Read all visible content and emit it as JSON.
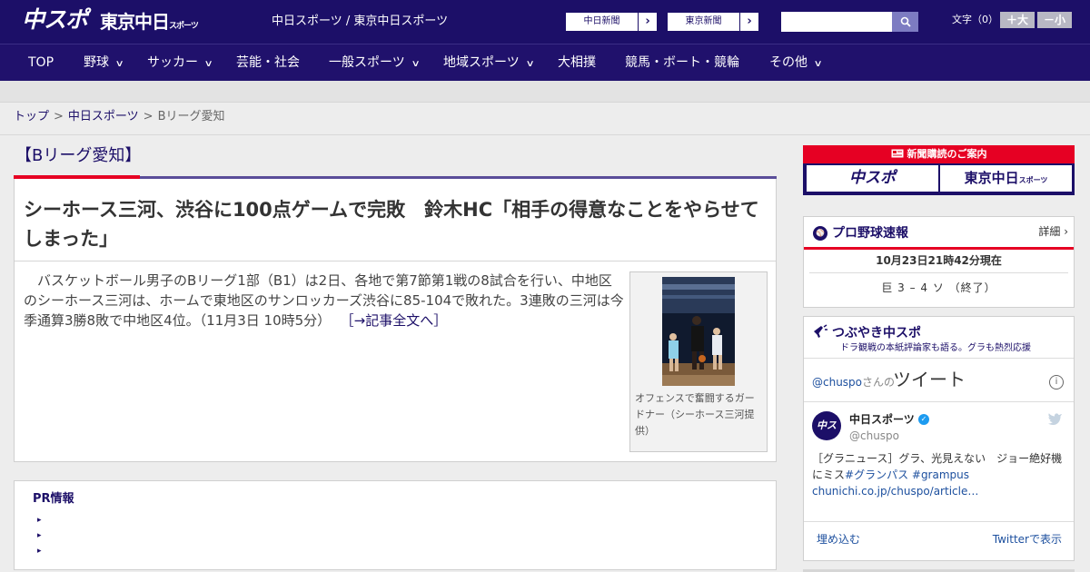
{
  "header": {
    "logo_main": "中スポ",
    "logo_sub": "東京中日",
    "logo_sub_small": "スポーツ",
    "site_title": "中日スポーツ / 東京中日スポーツ",
    "links": [
      {
        "label": "中日新聞",
        "arrow": "›"
      },
      {
        "label": "東京新聞",
        "arrow": "›"
      }
    ],
    "search": {
      "placeholder": "",
      "button_icon": "search-icon"
    },
    "font_size_label": "文字（0）",
    "font_larger": "＋大",
    "font_smaller": "－小"
  },
  "nav": {
    "items": [
      {
        "label": "TOP",
        "has_menu": false
      },
      {
        "label": "野球",
        "has_menu": true
      },
      {
        "label": "サッカー",
        "has_menu": true
      },
      {
        "label": "芸能・社会",
        "has_menu": false
      },
      {
        "label": "一般スポーツ",
        "has_menu": true
      },
      {
        "label": "地域スポーツ",
        "has_menu": true
      },
      {
        "label": "大相撲",
        "has_menu": false
      },
      {
        "label": "競馬・ボート・競輪",
        "has_menu": false
      },
      {
        "label": "その他",
        "has_menu": true
      }
    ]
  },
  "breadcrumb": {
    "home": "トップ",
    "section": "中日スポーツ",
    "current": "Bリーグ愛知",
    "separator": ">"
  },
  "article": {
    "category": "【Bリーグ愛知】",
    "title": "シーホース三河、渋谷に100点ゲームで完敗　鈴木HC「相手の得意なことをやらせてしまった」",
    "body": "　バスケットボール男子のBリーグ1部（B1）は2日、各地で第7節第1戦の8試合を行い、中地区のシーホース三河は、ホームで東地区のサンロッカーズ渋谷に85-104で敗れた。3連敗の三河は今季通算3勝8敗で中地区4位。（11月3日 10時5分）",
    "more_link": "［→記事全文へ］",
    "photo_caption": "オフェンスで奮闘するガードナー（シーホース三河提供）"
  },
  "pr": {
    "title": "PR情報",
    "bullets": [
      "▸",
      "▸",
      "▸"
    ]
  },
  "sidebar": {
    "subscribe": {
      "header": "新聞購読のご案内",
      "buttons": [
        "中スポ",
        "東京中日"
      ],
      "button_small": "スポーツ"
    },
    "baseball": {
      "icon": "baseball-icon",
      "title": "プロ野球速報",
      "detail": "詳細 ›",
      "timestamp": "10月23日21時42分現在",
      "game": "巨 3 – 4 ソ （終了）"
    },
    "twitter": {
      "title": "つぶやき中スポ",
      "subtitle": "ドラ観戦の本紙評論家も語る。グラも熱烈応援",
      "handle": "@chuspo",
      "handle_suffix": "さんの",
      "heading": "ツイート",
      "info": "i",
      "account_name": "中日スポーツ",
      "username": "@chuspo",
      "avatar_text": "中スポ",
      "tweet_text": "［グラニュース］グラ、光見えない　ジョー絶好機にミス",
      "tweet_tags": "#グランパス #grampus",
      "tweet_link": "chunichi.co.jp/chuspo/article…",
      "embed": "埋め込む",
      "view": "Twitterで表示"
    }
  },
  "colors": {
    "brand_navy": "#1c0f68",
    "accent_red": "#e60023",
    "link_blue": "#1c4f9e"
  }
}
